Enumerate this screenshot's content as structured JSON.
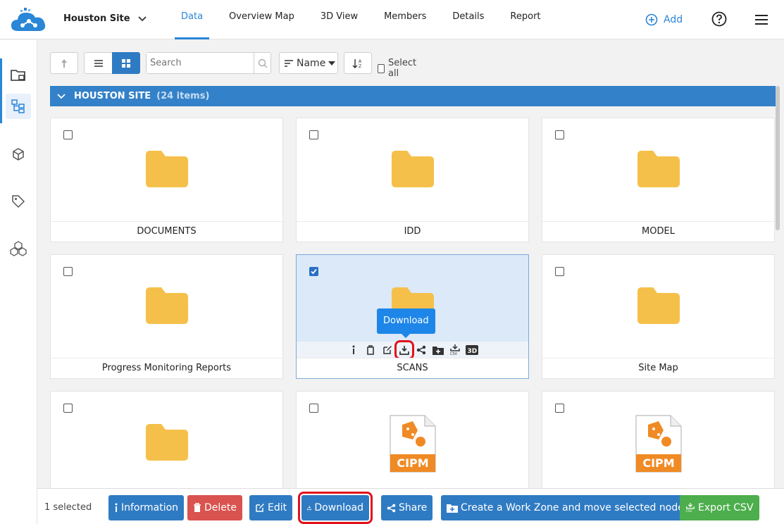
{
  "header": {
    "site_name": "Houston Site",
    "tabs": [
      {
        "label": "Data",
        "active": true
      },
      {
        "label": "Overview Map"
      },
      {
        "label": "3D View"
      },
      {
        "label": "Members"
      },
      {
        "label": "Details"
      },
      {
        "label": "Report"
      }
    ],
    "add_label": "Add",
    "accent": "#2a86d6"
  },
  "toolbar": {
    "search_placeholder": "Search",
    "sort_label": "Name",
    "select_all_label": "Select all"
  },
  "section": {
    "title": "HOUSTON SITE",
    "count": "(24 items)",
    "color": "#3381c9"
  },
  "items": [
    {
      "label": "DOCUMENTS",
      "type": "folder",
      "checked": false
    },
    {
      "label": "IDD",
      "type": "folder",
      "checked": false
    },
    {
      "label": "MODEL",
      "type": "folder",
      "checked": false
    },
    {
      "label": "Progress Monitoring Reports",
      "type": "folder",
      "checked": false
    },
    {
      "label": "SCANS",
      "type": "folder",
      "checked": true
    },
    {
      "label": "Site Map",
      "type": "folder",
      "checked": false
    },
    {
      "label": "",
      "type": "folder",
      "checked": false
    },
    {
      "label": "",
      "type": "cipm",
      "checked": false,
      "badge": "CIPM"
    },
    {
      "label": "",
      "type": "cipm",
      "checked": false,
      "badge": "CIPM"
    }
  ],
  "tooltip": "Download",
  "bottom": {
    "selected_count": "1 selected",
    "buttons": {
      "information": "Information",
      "delete": "Delete",
      "edit": "Edit",
      "download": "Download",
      "share": "Share",
      "workzone": "Create a Work Zone and move selected nodes",
      "export": "Export CSV"
    }
  }
}
